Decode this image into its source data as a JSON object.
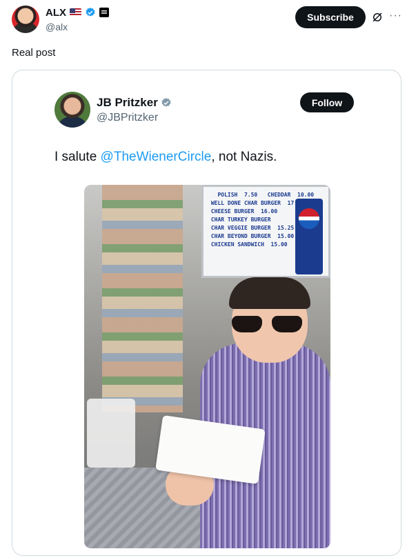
{
  "post": {
    "author_name": "ALX",
    "author_handle": "@alx",
    "subscribe_label": "Subscribe",
    "more_label": "···",
    "text": "Real post"
  },
  "quoted_post": {
    "author_name": "JB Pritzker",
    "author_handle": "@JBPritzker",
    "follow_label": "Follow",
    "text_before": "I salute ",
    "mention": "@TheWienerCircle",
    "text_after": ", not Nazis."
  },
  "photo": {
    "menu_board_lines": "   POLISH  7.50   CHEDDAR  10.00\n WELL DONE CHAR BURGER  17.50\n CHEESE BURGER  16.00\n CHAR TURKEY BURGER\n CHAR VEGGIE BURGER  15.25\n CHAR BEYOND BURGER  15.00\n CHICKEN SANDWICH  15.00"
  },
  "colors": {
    "accent": "#1d9bf0",
    "button_bg": "#0f1419",
    "muted_text": "#536471",
    "border": "#cfd9de"
  },
  "icons": [
    "verified-badge-icon",
    "us-flag-icon",
    "org-badge-icon",
    "grok-icon",
    "more-options-icon"
  ]
}
